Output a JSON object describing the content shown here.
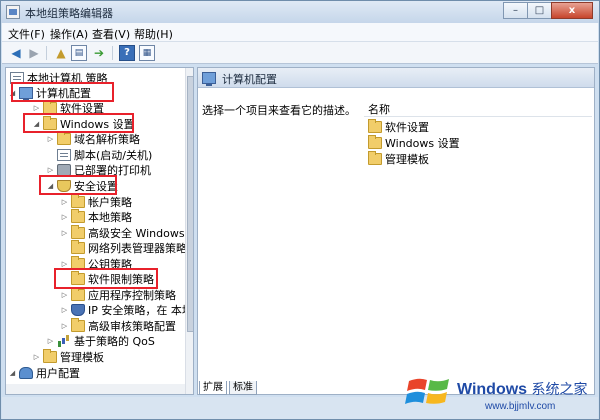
{
  "window": {
    "title": "本地组策略编辑器",
    "minimize": "–",
    "maximize": "□",
    "close": "x"
  },
  "menu": [
    "文件(F)",
    "操作(A)",
    "查看(V)",
    "帮助(H)"
  ],
  "tree": {
    "root": "本地计算机 策略",
    "computer_config": "计算机配置",
    "software_settings": "软件设置",
    "windows_settings": "Windows 设置",
    "dns_policy": "域名解析策略",
    "scripts": "脚本(启动/关机)",
    "deployed_printers": "已部署的打印机",
    "security_settings": "安全设置",
    "account_policies": "帐户策略",
    "local_policies": "本地策略",
    "advanced_firewall": "高级安全 Windows 防",
    "network_list": "网络列表管理器策略",
    "public_key": "公钥策略",
    "software_restriction": "软件限制策略",
    "app_control": "应用程序控制策略",
    "ip_security": "IP 安全策略，在 本地",
    "advanced_audit": "高级审核策略配置",
    "qos": "基于策略的 QoS",
    "admin_templates": "管理模板",
    "user_config": "用户配置"
  },
  "right": {
    "header": "计算机配置",
    "description": "选择一个项目来查看它的描述。",
    "column_name": "名称",
    "items": [
      "软件设置",
      "Windows 设置",
      "管理模板"
    ]
  },
  "tabs": [
    "扩展",
    "标准"
  ],
  "watermark": {
    "brand": "Windows",
    "brand_cn": "系统之家",
    "url": "www.bjjmlv.com"
  },
  "colors": {
    "highlight": "#e8212b",
    "titlebar": "#c5d6ea",
    "folder": "#f1cd6a"
  }
}
